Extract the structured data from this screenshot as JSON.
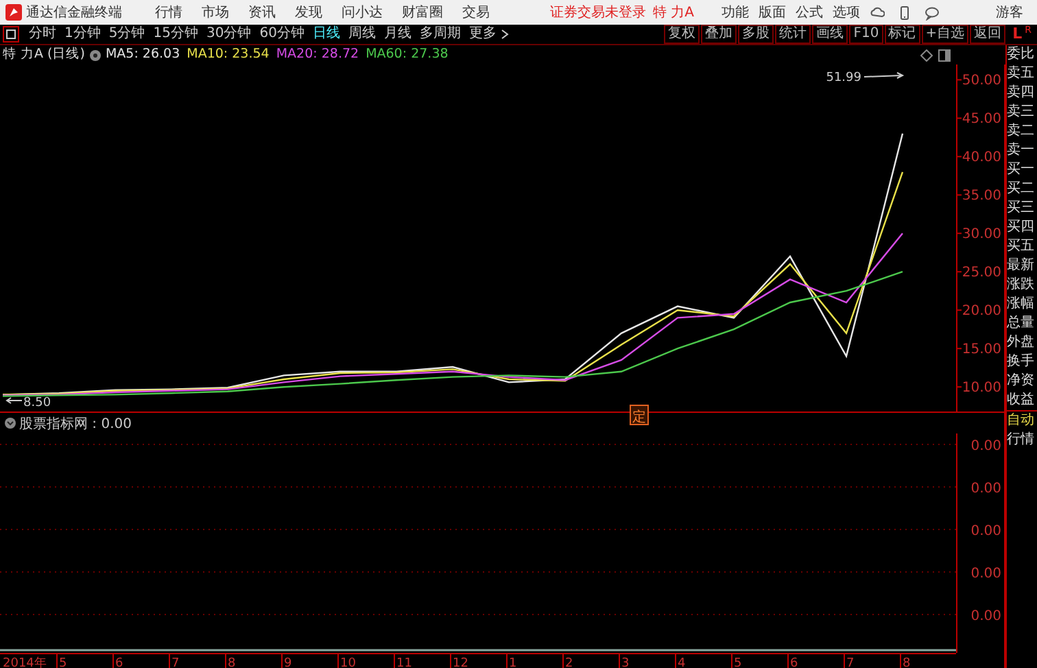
{
  "title_bar": {
    "app_name": "通达信金融终端",
    "menu": [
      "行情",
      "市场",
      "资讯",
      "发现",
      "问小达",
      "财富圈",
      "交易"
    ],
    "login_status": "证券交易未登录",
    "stock_name": "特 力A",
    "right_menu": [
      "功能",
      "版面",
      "公式",
      "选项"
    ],
    "user": "游客"
  },
  "period_tabs": [
    {
      "label": "分时",
      "selected": false
    },
    {
      "label": "1分钟",
      "selected": false
    },
    {
      "label": "5分钟",
      "selected": false
    },
    {
      "label": "15分钟",
      "selected": false
    },
    {
      "label": "30分钟",
      "selected": false
    },
    {
      "label": "60分钟",
      "selected": false
    },
    {
      "label": "日线",
      "selected": true
    },
    {
      "label": "周线",
      "selected": false
    },
    {
      "label": "月线",
      "selected": false
    },
    {
      "label": "多周期",
      "selected": false
    },
    {
      "label": "更多",
      "selected": false
    }
  ],
  "toolbar_buttons": [
    "复权",
    "叠加",
    "多股",
    "统计",
    "画线",
    "F10",
    "标记",
    "+自选",
    "返回"
  ],
  "side_header": {
    "left": "L",
    "right": "R"
  },
  "legend": {
    "stock": "特 力A (日线)",
    "values": [
      ": 26.03",
      ": 23.54",
      ": 28.72",
      ": 27.38"
    ]
  },
  "price_chart": {
    "chart_data": {
      "type": "line",
      "series": [
        {
          "name": "MA5",
          "color": "#e6e6e6",
          "values": [
            9.0,
            9.2,
            9.6,
            9.7,
            9.9,
            11.5,
            12.0,
            12.0,
            12.6,
            10.6,
            11.0,
            17.0,
            20.5,
            19.0,
            27.0,
            14.0,
            43.0
          ]
        },
        {
          "name": "MA10",
          "color": "#e8e04a",
          "values": [
            9.0,
            9.1,
            9.5,
            9.6,
            9.8,
            11.0,
            11.8,
            11.9,
            12.3,
            11.0,
            10.8,
            15.5,
            20.0,
            19.2,
            26.0,
            17.0,
            38.0
          ]
        },
        {
          "name": "MA20",
          "color": "#d64ce6",
          "values": [
            8.9,
            9.0,
            9.3,
            9.5,
            9.7,
            10.6,
            11.4,
            11.7,
            12.0,
            11.3,
            10.9,
            13.5,
            19.0,
            19.5,
            24.0,
            21.0,
            30.0
          ]
        },
        {
          "name": "MA60",
          "color": "#4cc84c",
          "values": [
            8.8,
            8.9,
            9.0,
            9.2,
            9.4,
            10.0,
            10.4,
            10.9,
            11.3,
            11.5,
            11.3,
            12.0,
            15.0,
            17.5,
            21.0,
            22.5,
            25.0
          ]
        }
      ],
      "ylim": [
        6.8,
        52
      ],
      "yticks": [
        {
          "value": 10,
          "label": "10.00"
        },
        {
          "value": 15,
          "label": "15.00"
        },
        {
          "value": 20,
          "label": "20.00"
        },
        {
          "value": 25,
          "label": "25.00"
        },
        {
          "value": 30,
          "label": "30.00"
        },
        {
          "value": 35,
          "label": "35.00"
        },
        {
          "value": 40,
          "label": "40.00"
        },
        {
          "value": 45,
          "label": "45.00"
        },
        {
          "value": 50,
          "label": "50.00"
        }
      ],
      "annotations": [
        "51.99",
        "8.50"
      ]
    },
    "event_marker": {
      "label": "定"
    }
  },
  "date_axis": {
    "labels": [
      "2014年",
      "5",
      "6",
      "7",
      "8",
      "9",
      "10",
      "11",
      "12",
      "1",
      "2",
      "3",
      "4",
      "5",
      "6",
      "7",
      "8"
    ]
  },
  "indicator_panel": {
    "title": "股票指标网 : 0.00",
    "axis_labels": [
      "0.00",
      "0.00",
      "0.00",
      "0.00",
      "0.00"
    ]
  },
  "side_panel": {
    "labels": [
      "委比",
      "卖五",
      "卖四",
      "卖三",
      "卖二",
      "卖一",
      "买一",
      "买二",
      "买三",
      "买四",
      "买五",
      "最新",
      "涨跌",
      "涨幅",
      "总量",
      "外盘",
      "换手",
      "净资",
      "收益"
    ],
    "tabs": [
      {
        "label": "自动",
        "selected": true
      },
      {
        "label": "行情",
        "selected": false
      }
    ]
  }
}
